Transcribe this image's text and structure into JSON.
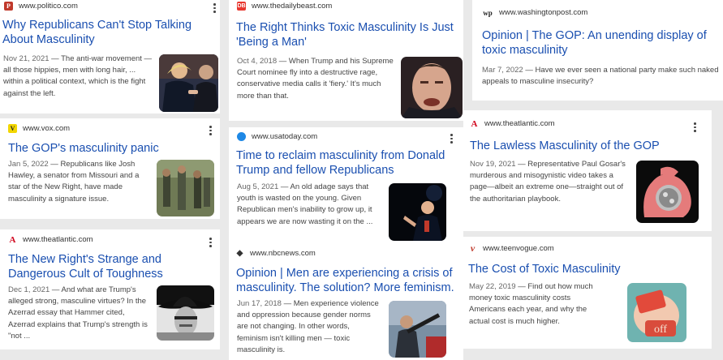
{
  "results": [
    {
      "source": "www.politico.com",
      "logo": "P",
      "logo_color": "#c0392b",
      "title": "Why Republicans Can't Stop Talking About Masculinity",
      "date": "Nov 21, 2021",
      "snippet": "The anti-war movement — all those hippies, men with long hair, ... within a political context, which is the fight against the left.",
      "thumb": "photo-two-men-handshake"
    },
    {
      "source": "www.vox.com",
      "logo": "V",
      "logo_color": "#f2d600",
      "title": "The GOP's masculinity panic",
      "date": "Jan 5, 2022",
      "snippet": "Republicans like Josh Hawley, a senator from Missouri and a star of the New Right, have made masculinity a signature issue.",
      "thumb": "photo-armed-men-outdoors"
    },
    {
      "source": "www.theatlantic.com",
      "logo": "A",
      "logo_color": "#d0021b",
      "title": "The New Right's Strange and Dangerous Cult of Toughness",
      "date": "Dec 1, 2021",
      "snippet": "And what are Trump's alleged strong, masculine virtues? In the Azerrad essay that Hammer cited, Azerrad explains that Trump's strength is \"not ...",
      "thumb": "illustration-cowboy-hat"
    },
    {
      "source": "www.thedailybeast.com",
      "logo": "DB",
      "logo_color": "#e8372f",
      "title": "The Right Thinks Toxic Masculinity Is Just 'Being a Man'",
      "date": "Oct 4, 2018",
      "snippet": "When Trump and his Supreme Court nominee fly into a destructive rage, conservative media calls it 'fiery.' It's much more than that.",
      "thumb": "photo-angry-man-closeup"
    },
    {
      "source": "www.usatoday.com",
      "logo": "●",
      "logo_color": "#1e88e5",
      "title": "Time to reclaim masculinity from Donald Trump and fellow Republicans",
      "date": "Aug 5, 2021",
      "snippet": "An old adage says that youth is wasted on the young. Given Republican men's inability to grow up, it appears we are now wasting it on the ...",
      "thumb": "photo-speaker-dark-stage"
    },
    {
      "source": "www.nbcnews.com",
      "logo": "◆",
      "logo_color": "#333333",
      "title": "Opinion | Men are experiencing a crisis of masculinity. The solution? More feminism.",
      "date": "Jun 17, 2018",
      "snippet": "Men experience violence and oppression because gender norms are not changing. In other words, feminism isn't killing men — toxic masculinity is.",
      "thumb": "photo-man-with-gun"
    },
    {
      "source": "www.washingtonpost.com",
      "logo": "wp",
      "logo_color": "#222222",
      "title": "Opinion | The GOP: An unending display of toxic masculinity",
      "date": "Mar 7, 2022",
      "snippet": "Have we ever seen a national party make such naked appeals to masculine insecurity?"
    },
    {
      "source": "www.theatlantic.com",
      "logo": "A",
      "logo_color": "#d0021b",
      "title": "The Lawless Masculinity of the GOP",
      "date": "Nov 19, 2021",
      "snippet": "Representative Paul Gosar's murderous and misogynistic video takes a page—albeit an extreme one—straight out of the authoritarian playbook.",
      "thumb": "illustration-flexed-arm"
    },
    {
      "source": "www.teenvogue.com",
      "logo": "v",
      "logo_color": "#c0392b",
      "title": "The Cost of Toxic Masculinity",
      "date": "May 22, 2019",
      "snippet": "Find out how much money toxic masculinity costs Americans each year, and why the actual cost is much higher.",
      "thumb": "illustration-price-tag-off"
    }
  ]
}
